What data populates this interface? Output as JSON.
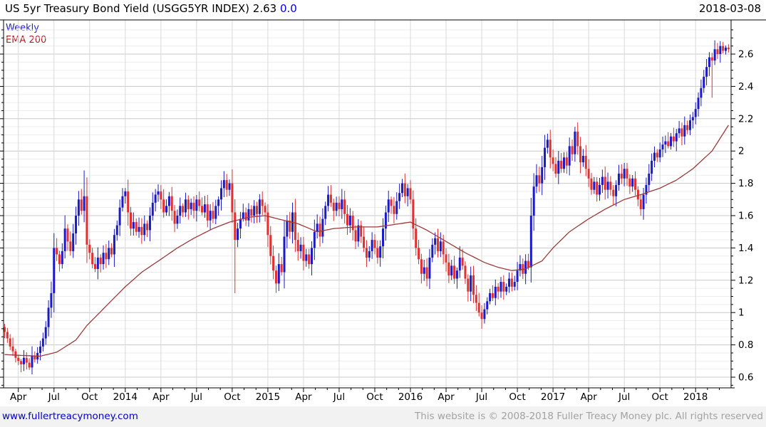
{
  "header": {
    "title": "US 5yr Treasury Bond Yield (USGG5YR INDEX)",
    "last_value": "2.63",
    "change": "0.0",
    "date": "2018-03-08"
  },
  "legend": {
    "series_label": "Weekly",
    "ema_label": "EMA 200"
  },
  "footer": {
    "website": "www.fullertreacymoney.com",
    "copyright": "This website is © 2008-2018 Fuller Treacy Money plc. All rights reserved"
  },
  "colors": {
    "candle_up": "#1a1ac8",
    "candle_down": "#e03030",
    "ema_line": "#993b3b",
    "title_change_blue": "#0000dd",
    "legend_weekly_blue": "#2222bb",
    "legend_ema_red": "#aa2222",
    "footer_link_blue": "#0000cc",
    "footer_copy_gray": "#a2a2a2",
    "grid_major": "#c8c8c8",
    "grid_minor": "#ededed",
    "grid_vertical": "#d9d9d9",
    "axis_black": "#000000",
    "footer_bg": "#f2f2f2"
  },
  "chart_data": {
    "type": "candlestick",
    "title": "US 5yr Treasury Bond Yield (USGG5YR INDEX)",
    "interval": "weekly",
    "last_close": 2.63,
    "change": 0.0,
    "ylim": [
      0.53,
      2.81
    ],
    "grid": "major+minor",
    "y_ticks": [
      {
        "v": 0.6,
        "label": "0.6"
      },
      {
        "v": 0.8,
        "label": "0.8"
      },
      {
        "v": 1.0,
        "label": "1"
      },
      {
        "v": 1.2,
        "label": "1.2"
      },
      {
        "v": 1.4,
        "label": "1.4"
      },
      {
        "v": 1.6,
        "label": "1.6"
      },
      {
        "v": 1.8,
        "label": "1.8"
      },
      {
        "v": 2.0,
        "label": "2"
      },
      {
        "v": 2.2,
        "label": "2.2"
      },
      {
        "v": 2.4,
        "label": "2.4"
      },
      {
        "v": 2.6,
        "label": "2.6"
      }
    ],
    "x_ticks": [
      {
        "week": 5,
        "label": "Apr"
      },
      {
        "week": 18,
        "label": "Jul"
      },
      {
        "week": 31,
        "label": "Oct"
      },
      {
        "week": 44,
        "label": "2014"
      },
      {
        "week": 57,
        "label": "Apr"
      },
      {
        "week": 70,
        "label": "Jul"
      },
      {
        "week": 83,
        "label": "Oct"
      },
      {
        "week": 96,
        "label": "2015"
      },
      {
        "week": 109,
        "label": "Apr"
      },
      {
        "week": 122,
        "label": "Jul"
      },
      {
        "week": 135,
        "label": "Oct"
      },
      {
        "week": 148,
        "label": "2016"
      },
      {
        "week": 161,
        "label": "Apr"
      },
      {
        "week": 174,
        "label": "Jul"
      },
      {
        "week": 187,
        "label": "Oct"
      },
      {
        "week": 200,
        "label": "2017"
      },
      {
        "week": 213,
        "label": "Apr"
      },
      {
        "week": 226,
        "label": "Jul"
      },
      {
        "week": 239,
        "label": "Oct"
      },
      {
        "week": 252,
        "label": "2018"
      }
    ],
    "weekly_closes": [
      0.88,
      0.84,
      0.79,
      0.76,
      0.72,
      0.7,
      0.68,
      0.72,
      0.69,
      0.66,
      0.73,
      0.71,
      0.75,
      0.79,
      0.84,
      0.91,
      1.03,
      1.12,
      1.4,
      1.36,
      1.3,
      1.38,
      1.52,
      1.44,
      1.38,
      1.49,
      1.6,
      1.7,
      1.63,
      1.72,
      1.42,
      1.37,
      1.3,
      1.27,
      1.34,
      1.3,
      1.37,
      1.33,
      1.4,
      1.36,
      1.48,
      1.54,
      1.65,
      1.72,
      1.75,
      1.62,
      1.52,
      1.56,
      1.5,
      1.53,
      1.48,
      1.55,
      1.51,
      1.6,
      1.68,
      1.73,
      1.75,
      1.7,
      1.62,
      1.66,
      1.72,
      1.63,
      1.55,
      1.6,
      1.66,
      1.62,
      1.7,
      1.64,
      1.68,
      1.63,
      1.7,
      1.66,
      1.62,
      1.67,
      1.57,
      1.63,
      1.58,
      1.66,
      1.7,
      1.77,
      1.82,
      1.76,
      1.8,
      1.62,
      1.45,
      1.52,
      1.58,
      1.62,
      1.57,
      1.64,
      1.6,
      1.66,
      1.61,
      1.7,
      1.66,
      1.62,
      1.48,
      1.35,
      1.26,
      1.18,
      1.3,
      1.25,
      1.47,
      1.57,
      1.5,
      1.62,
      1.45,
      1.38,
      1.42,
      1.32,
      1.36,
      1.3,
      1.4,
      1.5,
      1.55,
      1.47,
      1.58,
      1.66,
      1.73,
      1.68,
      1.63,
      1.68,
      1.64,
      1.7,
      1.61,
      1.54,
      1.6,
      1.51,
      1.44,
      1.54,
      1.47,
      1.4,
      1.34,
      1.38,
      1.45,
      1.4,
      1.34,
      1.41,
      1.52,
      1.62,
      1.7,
      1.66,
      1.61,
      1.69,
      1.74,
      1.8,
      1.72,
      1.77,
      1.7,
      1.52,
      1.4,
      1.33,
      1.24,
      1.28,
      1.21,
      1.34,
      1.42,
      1.46,
      1.38,
      1.44,
      1.36,
      1.31,
      1.23,
      1.29,
      1.21,
      1.26,
      1.34,
      1.29,
      1.21,
      1.13,
      1.23,
      1.11,
      1.06,
      1.0,
      0.96,
      1.02,
      1.07,
      1.12,
      1.09,
      1.16,
      1.13,
      1.19,
      1.13,
      1.16,
      1.21,
      1.16,
      1.19,
      1.26,
      1.3,
      1.24,
      1.32,
      1.28,
      1.6,
      1.78,
      1.85,
      1.8,
      1.9,
      2.02,
      2.07,
      1.96,
      1.92,
      1.86,
      1.94,
      1.89,
      1.96,
      1.91,
      2.03,
      1.98,
      2.12,
      2.03,
      1.93,
      1.97,
      1.89,
      1.83,
      1.76,
      1.81,
      1.73,
      1.79,
      1.84,
      1.76,
      1.81,
      1.76,
      1.72,
      1.79,
      1.86,
      1.83,
      1.89,
      1.83,
      1.78,
      1.83,
      1.76,
      1.7,
      1.64,
      1.73,
      1.79,
      1.86,
      1.94,
      1.99,
      1.96,
      2.01,
      2.04,
      2.06,
      2.03,
      2.09,
      2.06,
      2.11,
      2.14,
      2.09,
      2.16,
      2.13,
      2.19,
      2.21,
      2.26,
      2.33,
      2.39,
      2.46,
      2.52,
      2.58,
      2.56,
      2.63,
      2.6,
      2.65,
      2.62,
      2.64,
      2.63
    ],
    "open_overrides": {
      "0": 0.91
    },
    "wick_overrides": {
      "0": {
        "high": 0.93
      },
      "29": {
        "high": 1.88
      },
      "84": {
        "low": 1.12
      },
      "148": {
        "high": 1.82
      },
      "174": {
        "low": 0.9
      },
      "197": {
        "high": 2.1
      },
      "208": {
        "high": 2.15
      },
      "232": {
        "low": 1.6
      },
      "258": {
        "low": 2.33
      },
      "261": {
        "high": 2.68
      }
    },
    "ema_200_anchors": [
      [
        0,
        0.74
      ],
      [
        6,
        0.735
      ],
      [
        13,
        0.73
      ],
      [
        19,
        0.755
      ],
      [
        26,
        0.83
      ],
      [
        30,
        0.92
      ],
      [
        37,
        1.04
      ],
      [
        44,
        1.16
      ],
      [
        50,
        1.25
      ],
      [
        57,
        1.33
      ],
      [
        63,
        1.4
      ],
      [
        69,
        1.46
      ],
      [
        76,
        1.52
      ],
      [
        82,
        1.56
      ],
      [
        89,
        1.59
      ],
      [
        95,
        1.6
      ],
      [
        102,
        1.57
      ],
      [
        107,
        1.55
      ],
      [
        114,
        1.5
      ],
      [
        120,
        1.52
      ],
      [
        128,
        1.53
      ],
      [
        136,
        1.53
      ],
      [
        144,
        1.55
      ],
      [
        148,
        1.56
      ],
      [
        154,
        1.51
      ],
      [
        161,
        1.44
      ],
      [
        168,
        1.37
      ],
      [
        175,
        1.31
      ],
      [
        180,
        1.28
      ],
      [
        185,
        1.26
      ],
      [
        190,
        1.27
      ],
      [
        196,
        1.32
      ],
      [
        200,
        1.4
      ],
      [
        206,
        1.5
      ],
      [
        213,
        1.58
      ],
      [
        219,
        1.64
      ],
      [
        226,
        1.7
      ],
      [
        232,
        1.73
      ],
      [
        239,
        1.77
      ],
      [
        245,
        1.82
      ],
      [
        251,
        1.89
      ],
      [
        258,
        2.0
      ],
      [
        264,
        2.16
      ]
    ]
  }
}
